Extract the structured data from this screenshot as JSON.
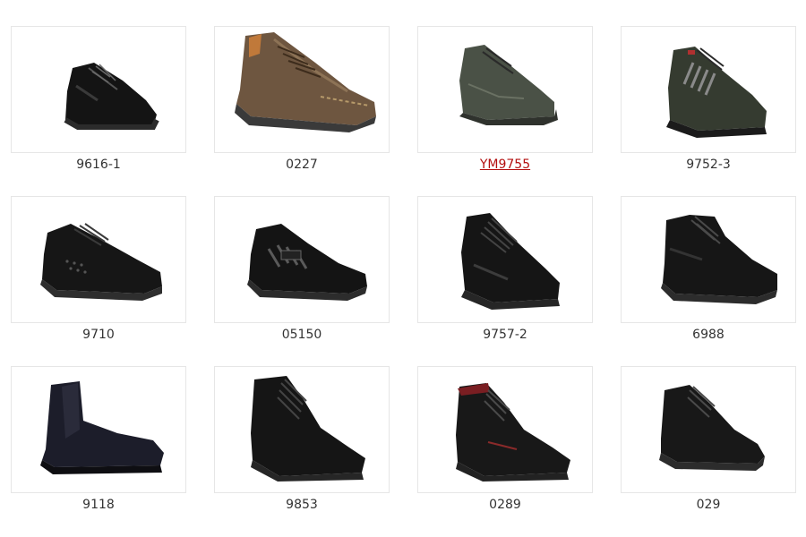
{
  "products": [
    {
      "code": "9616-1",
      "icon": "low-cut-black-safety-shoe"
    },
    {
      "code": "0227",
      "icon": "brown-suede-casual-shoe"
    },
    {
      "code": "YM9755",
      "icon": "grey-green-sport-safety-shoe",
      "active": true,
      "active_color": "#b30f0f"
    },
    {
      "code": "9752-3",
      "icon": "green-sport-safety-shoe"
    },
    {
      "code": "9710",
      "icon": "perforated-black-safety-shoe"
    },
    {
      "code": "05150",
      "icon": "black-sandal-safety-shoe"
    },
    {
      "code": "9757-2",
      "icon": "black-lace-safety-shoe"
    },
    {
      "code": "6988",
      "icon": "black-mid-cut-safety-boot"
    },
    {
      "code": "9118",
      "icon": "black-chelsea-safety-boot"
    },
    {
      "code": "9853",
      "icon": "black-high-cut-safety-boot"
    },
    {
      "code": "0289",
      "icon": "black-red-lining-safety-boot"
    },
    {
      "code": "029",
      "icon": "black-mid-cut-lace-boot"
    }
  ]
}
